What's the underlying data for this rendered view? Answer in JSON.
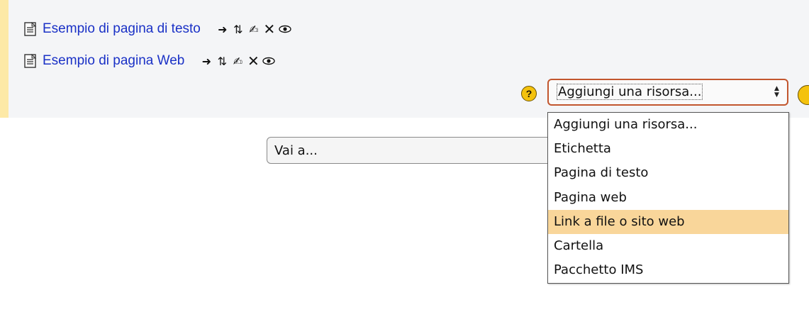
{
  "resources": [
    {
      "title": "Esempio di pagina di testo",
      "icon": "text-page-icon"
    },
    {
      "title": "Esempio di pagina Web",
      "icon": "web-page-icon"
    }
  ],
  "action_icons": [
    "move-right-icon",
    "move-updown-icon",
    "edit-icon",
    "delete-icon",
    "visibility-eye-icon"
  ],
  "help_icon": "?",
  "add_resource": {
    "current": "Aggiungi una risorsa...",
    "options": [
      "Aggiungi una risorsa...",
      "Etichetta",
      "Pagina di testo",
      "Pagina web",
      "Link a file o sito web",
      "Cartella",
      "Pacchetto IMS"
    ],
    "highlighted": "Link a file o sito web"
  },
  "jump_menu": {
    "current": "Vai a..."
  },
  "colors": {
    "link": "#1a31c6",
    "highlight": "#f9d69a",
    "section_marker": "#fde9a6",
    "focus_border": "#c2562e"
  }
}
